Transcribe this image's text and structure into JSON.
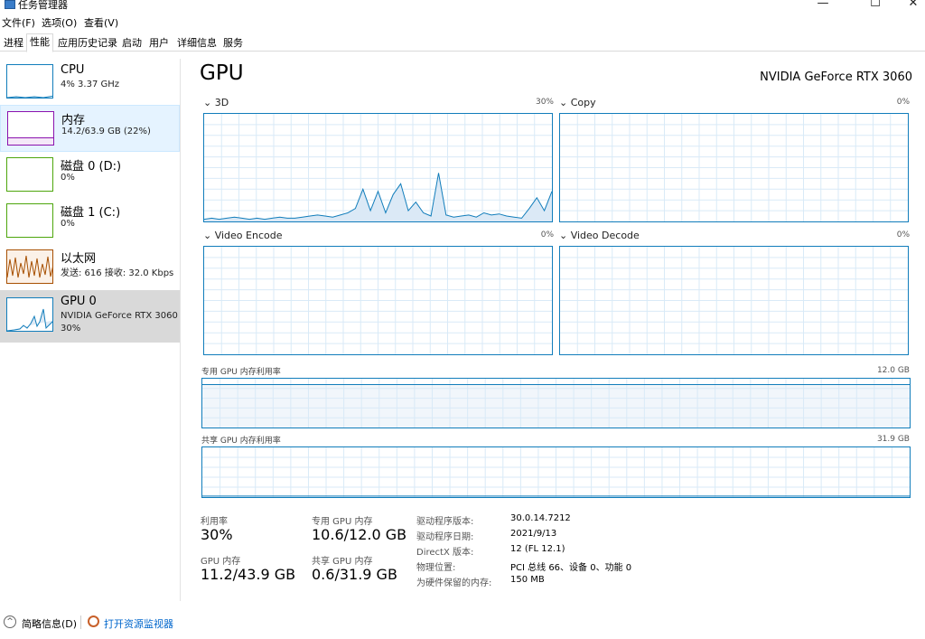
{
  "window": {
    "title": "任务管理器",
    "minimize_glyph": "—",
    "maximize_glyph": "☐",
    "close_glyph": "✕",
    "app_icon": "task-manager-icon"
  },
  "menu": [
    "文件(F)",
    "选项(O)",
    "查看(V)"
  ],
  "tabs": [
    "进程",
    "性能",
    "应用历史记录",
    "启动",
    "用户",
    "详细信息",
    "服务"
  ],
  "active_tab": "性能",
  "sidebar": {
    "items": [
      {
        "name": "CPU",
        "sub": "4%  3.37 GHz",
        "color": "#117dbb"
      },
      {
        "name": "内存",
        "sub": "14.2/63.9 GB (22%)",
        "color": "#8b12ae"
      },
      {
        "name": "磁盘 0 (D:)",
        "sub": "0%",
        "color": "#4da60c"
      },
      {
        "name": "磁盘 1 (C:)",
        "sub": "0%",
        "color": "#4da60c"
      },
      {
        "name": "以太网",
        "sub": "发送: 616  接收: 32.0 Kbps",
        "color": "#a74f01"
      },
      {
        "name": "GPU 0",
        "sub": "NVIDIA GeForce RTX 3060",
        "sub2": "30%",
        "color": "#117dbb"
      }
    ]
  },
  "main": {
    "title": "GPU",
    "model": "NVIDIA GeForce RTX 3060",
    "panels": {
      "p3d": {
        "label": "3D",
        "pct": "30%"
      },
      "copy": {
        "label": "Copy",
        "pct": "0%"
      },
      "encode": {
        "label": "Video Encode",
        "pct": "0%"
      },
      "decode": {
        "label": "Video Decode",
        "pct": "0%"
      }
    },
    "dedicated_label": "专用 GPU 内存利用率",
    "dedicated_max": "12.0 GB",
    "dedicated_fill": 0.88,
    "shared_label": "共享 GPU 内存利用率",
    "shared_max": "31.9 GB",
    "shared_fill": 0.02,
    "stats": {
      "util_label": "利用率",
      "util_value": "30%",
      "ded_label": "专用 GPU 内存",
      "ded_value": "10.6/12.0 GB",
      "gmem_label": "GPU 内存",
      "gmem_value": "11.2/43.9 GB",
      "shr_label": "共享 GPU 内存",
      "shr_value": "0.6/31.9 GB"
    },
    "info": [
      {
        "label": "驱动程序版本:",
        "value": "30.0.14.7212"
      },
      {
        "label": "驱动程序日期:",
        "value": "2021/9/13"
      },
      {
        "label": "DirectX 版本:",
        "value": "12 (FL 12.1)"
      },
      {
        "label": "物理位置:",
        "value": "PCI 总线 66、设备 0、功能 0"
      },
      {
        "label": "为硬件保留的内存:",
        "value": "150 MB"
      }
    ],
    "graph_3d_values": [
      2,
      3,
      2,
      3,
      4,
      3,
      2,
      3,
      2,
      3,
      4,
      3,
      3,
      4,
      5,
      6,
      5,
      4,
      6,
      8,
      12,
      30,
      10,
      28,
      8,
      25,
      35,
      10,
      18,
      8,
      5,
      45,
      6,
      4,
      5,
      6,
      4,
      8,
      6,
      7,
      5,
      4,
      3,
      12,
      22,
      10,
      28
    ],
    "chart_data": {
      "type": "line",
      "title": "3D",
      "ylim": [
        0,
        100
      ],
      "series": [
        {
          "name": "3D",
          "values": [
            2,
            3,
            2,
            3,
            4,
            3,
            2,
            3,
            2,
            3,
            4,
            3,
            3,
            4,
            5,
            6,
            5,
            4,
            6,
            8,
            12,
            30,
            10,
            28,
            8,
            25,
            35,
            10,
            18,
            8,
            5,
            45,
            6,
            4,
            5,
            6,
            4,
            8,
            6,
            7,
            5,
            4,
            3,
            12,
            22,
            10,
            28
          ]
        }
      ]
    }
  },
  "footer": {
    "brief": "简略信息(D)",
    "monitor": "打开资源监视器",
    "collapse_icon": "chevron-up-icon",
    "monitor_icon": "resource-monitor-icon"
  }
}
